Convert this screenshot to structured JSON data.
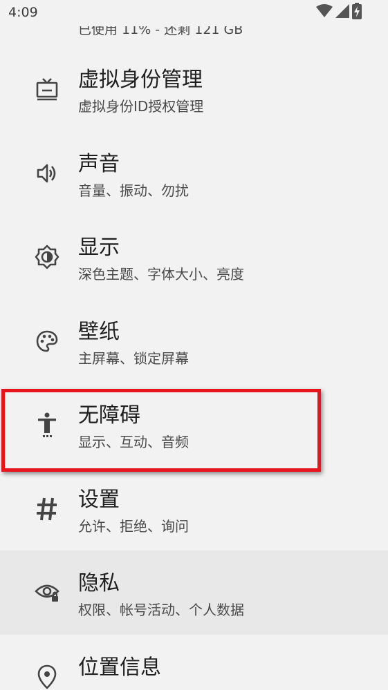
{
  "status_bar": {
    "time": "4:09",
    "icons": [
      "wifi-icon",
      "cellular-signal-icon",
      "battery-charging-icon"
    ]
  },
  "storage_summary_partial": "已使用 11% - 还剩 121 GB",
  "settings_items": [
    {
      "title": "虚拟身份管理",
      "summary": "虚拟身份ID授权管理",
      "icon": "tv-icon"
    },
    {
      "title": "声音",
      "summary": "音量、振动、勿扰",
      "icon": "volume-icon"
    },
    {
      "title": "显示",
      "summary": "深色主题、字体大小、亮度",
      "icon": "brightness-icon"
    },
    {
      "title": "壁纸",
      "summary": "主屏幕、锁定屏幕",
      "icon": "palette-icon"
    },
    {
      "title": "无障碍",
      "summary": "显示、互动、音频",
      "icon": "accessibility-icon"
    },
    {
      "title": "设置",
      "summary": "允许、拒绝、询问",
      "icon": "hash-icon"
    },
    {
      "title": "隐私",
      "summary": "权限、帐号活动、个人数据",
      "icon": "privacy-eye-icon"
    },
    {
      "title": "位置信息",
      "summary": "",
      "icon": "location-pin-icon"
    }
  ],
  "colors": {
    "background": "#f2f2f2",
    "highlighted_row": "#e8e8e8",
    "annotation_box": "#e8141c",
    "icon": "#444444"
  }
}
